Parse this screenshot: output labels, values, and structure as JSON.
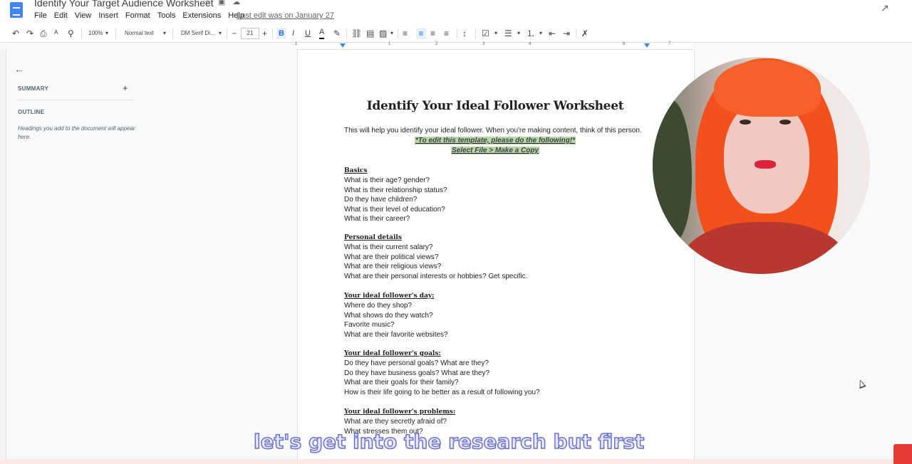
{
  "app": {
    "doc_title": "Identify Your Target Audience Worksheet",
    "menu": [
      "File",
      "Edit",
      "View",
      "Insert",
      "Format",
      "Tools",
      "Extensions",
      "Help"
    ],
    "last_edit": "Last edit was on January 27"
  },
  "toolbar": {
    "zoom": "100%",
    "style": "Normal text",
    "font": "DM Serif Di...",
    "font_size": "21",
    "bold": "B",
    "italic": "I",
    "underline": "U",
    "text_color": "A"
  },
  "ruler": {
    "numbers": [
      "1",
      "1",
      "2",
      "3",
      "4",
      "5",
      "6",
      "7"
    ]
  },
  "sidebar": {
    "summary_label": "SUMMARY",
    "outline_label": "OUTLINE",
    "outline_hint": "Headings you add to the document will appear here."
  },
  "document": {
    "title": "Identify Your Ideal Follower Worksheet",
    "intro": "This will help you identify your ideal follower. When you're making content, think of this person.",
    "instruction_1": "*To edit this template, please do the following!*",
    "instruction_2": "Select File > Make a Copy",
    "sections": [
      {
        "heading": "Basics",
        "items": [
          "What is their age? gender?",
          "What is their relationship status?",
          "Do they have children?",
          "What is their level of education?",
          "What is their career?"
        ]
      },
      {
        "heading": "Personal details",
        "items": [
          "What is their current salary?",
          "What are their political views?",
          "What are their religious views?",
          "What are their personal interests or hobbies? Get specific."
        ]
      },
      {
        "heading": "Your ideal follower's day:",
        "items": [
          "Where do they shop?",
          "What shows do they watch?",
          "Favorite music?",
          "What are their favorite websites?"
        ]
      },
      {
        "heading": "Your ideal follower's goals:",
        "items": [
          "Do they have personal goals? What are they?",
          "Do they have business goals? What are they?",
          "What are their goals for their family?",
          "How is their life going to be better as a result of following you?"
        ]
      },
      {
        "heading": "Your ideal follower's problems:",
        "items": [
          "What are they secretly afraid of?",
          "What stresses them out?"
        ]
      }
    ]
  },
  "caption": "let's get into the research but first",
  "colors": {
    "highlight": "#b7d7a8",
    "accent": "#4285f4",
    "caption_stroke": "#6a6fd6"
  }
}
